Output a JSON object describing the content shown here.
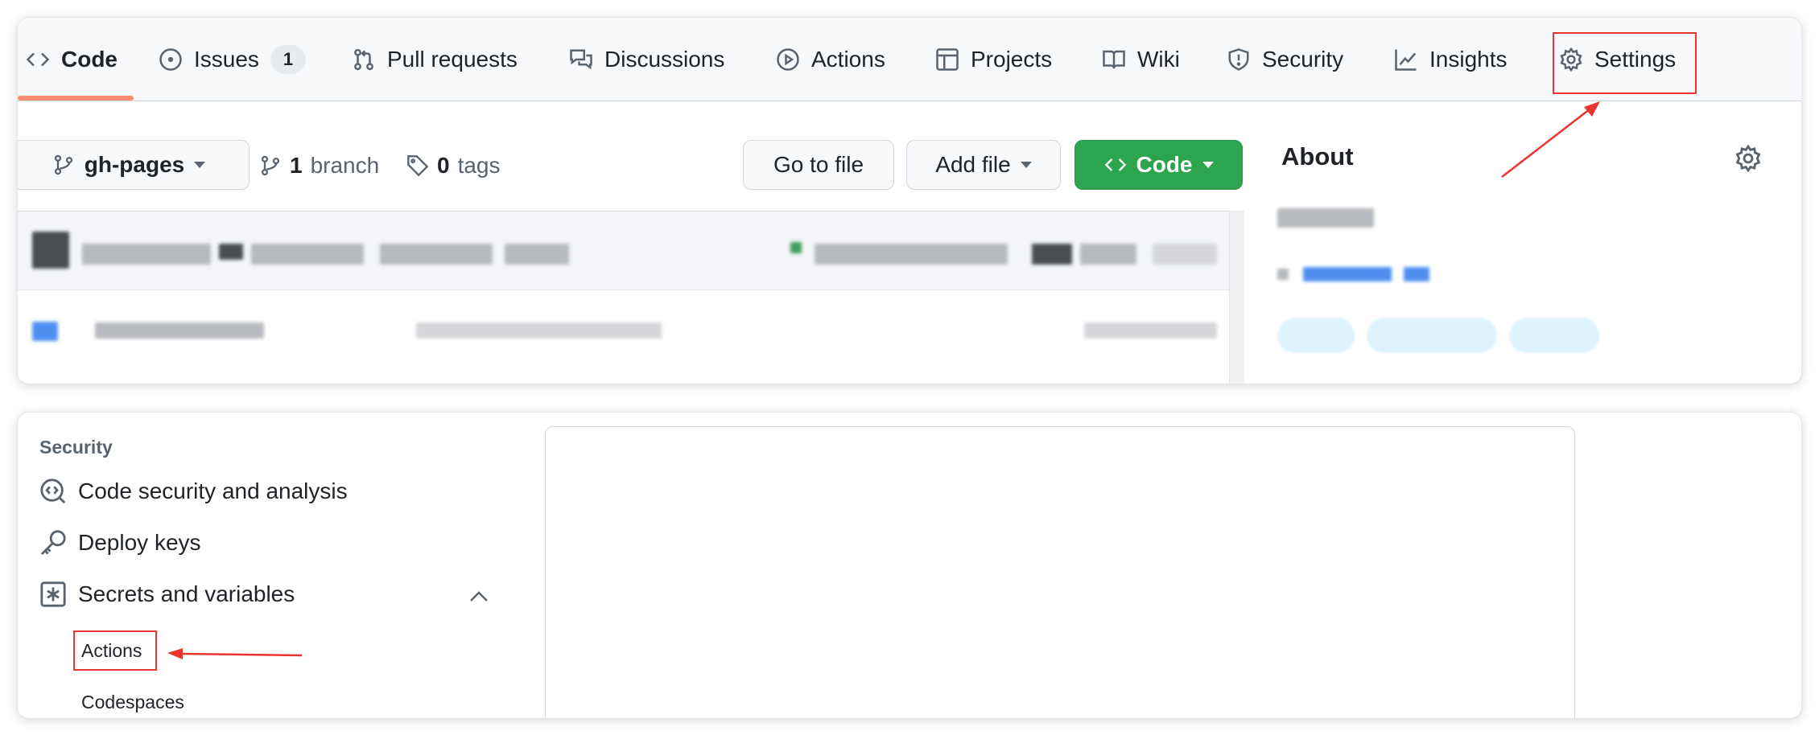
{
  "repo_nav": {
    "tabs": [
      {
        "label": "Code",
        "icon": "code-icon"
      },
      {
        "label": "Issues",
        "icon": "issue-opened-icon",
        "count": "1"
      },
      {
        "label": "Pull requests",
        "icon": "git-pull-request-icon"
      },
      {
        "label": "Discussions",
        "icon": "comment-discussion-icon"
      },
      {
        "label": "Actions",
        "icon": "play-icon"
      },
      {
        "label": "Projects",
        "icon": "table-icon"
      },
      {
        "label": "Wiki",
        "icon": "book-icon"
      },
      {
        "label": "Security",
        "icon": "shield-icon"
      },
      {
        "label": "Insights",
        "icon": "graph-icon"
      },
      {
        "label": "Settings",
        "icon": "gear-icon"
      }
    ]
  },
  "toolbar": {
    "branch_label": "gh-pages",
    "branches_count": "1",
    "branches_word": "branch",
    "tags_count": "0",
    "tags_word": "tags",
    "go_to_file": "Go to file",
    "add_file": "Add file",
    "code_button": "Code"
  },
  "about": {
    "title": "About"
  },
  "settings_sidebar": {
    "section_heading": "Security",
    "items": [
      {
        "label": "Code security and analysis",
        "icon": "codescan-icon"
      },
      {
        "label": "Deploy keys",
        "icon": "key-icon"
      },
      {
        "label": "Secrets and variables",
        "icon": "asterisk-icon"
      }
    ],
    "sub_items": [
      "Actions",
      "Codespaces"
    ]
  },
  "colors": {
    "accent_green": "#2da44e",
    "tab_underline": "#fd8c73",
    "annotation_red": "#e8352f"
  }
}
